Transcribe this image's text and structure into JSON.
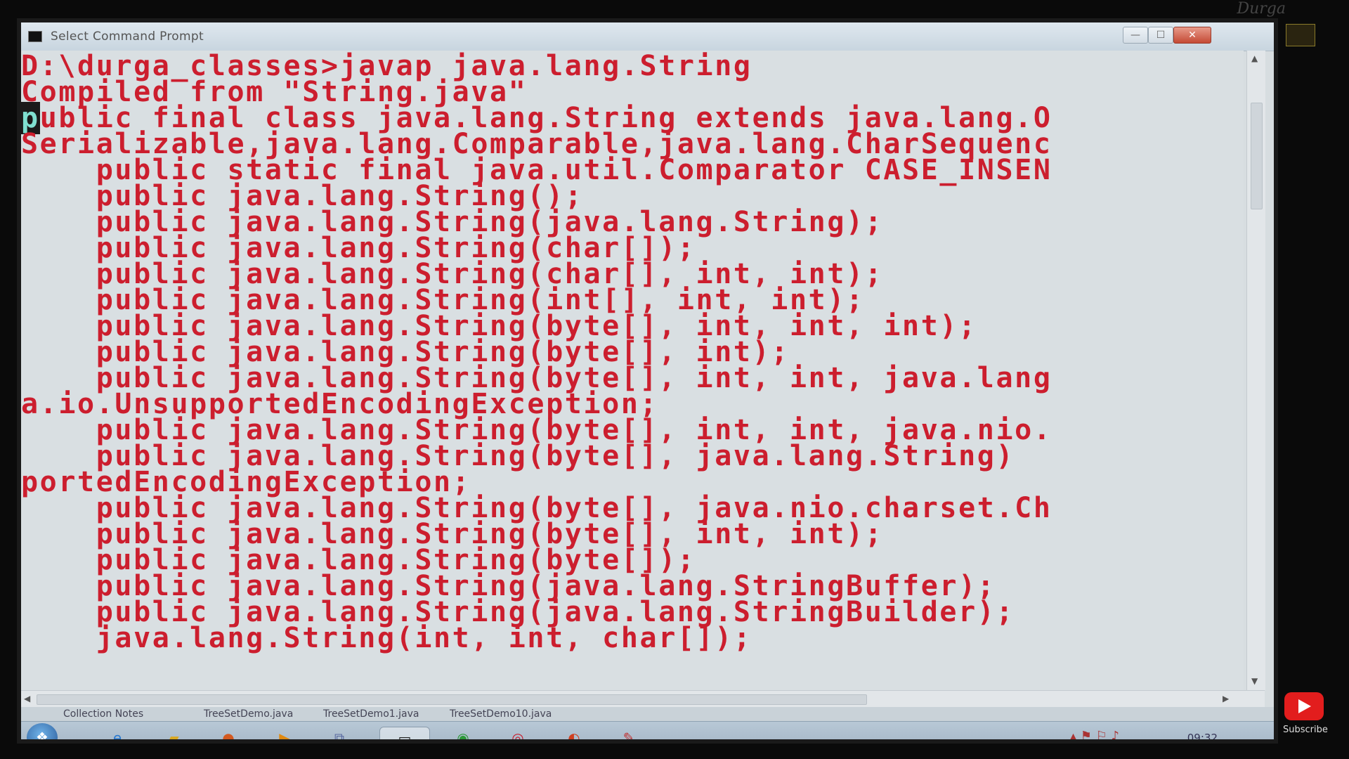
{
  "window": {
    "title": "Select Command Prompt",
    "min_label": "—",
    "max_label": "☐",
    "close_label": "✕"
  },
  "console": {
    "lines": [
      "D:\\durga_classes>javap java.lang.String",
      "Compiled from \"String.java\"",
      "public final class java.lang.String extends java.lang.O",
      "Serializable,java.lang.Comparable,java.lang.CharSequenc",
      "    public static final java.util.Comparator CASE_INSEN",
      "    public java.lang.String();",
      "    public java.lang.String(java.lang.String);",
      "    public java.lang.String(char[]);",
      "    public java.lang.String(char[], int, int);",
      "    public java.lang.String(int[], int, int);",
      "    public java.lang.String(byte[], int, int, int);",
      "    public java.lang.String(byte[], int);",
      "    public java.lang.String(byte[], int, int, java.lang",
      "a.io.UnsupportedEncodingException;",
      "    public java.lang.String(byte[], int, int, java.nio.",
      "    public java.lang.String(byte[], java.lang.String)",
      "portedEncodingException;",
      "    public java.lang.String(byte[], java.nio.charset.Ch",
      "    public java.lang.String(byte[], int, int);",
      "    public java.lang.String(byte[]);",
      "    public java.lang.String(java.lang.StringBuffer);",
      "    public java.lang.String(java.lang.StringBuilder);",
      "    java.lang.String(int, int, char[]);"
    ]
  },
  "tabs": [
    "Collection Notes",
    "TreeSetDemo.java",
    "TreeSetDemo1.java",
    "TreeSetDemo10.java"
  ],
  "taskbar": {
    "start_glyph": "❖",
    "clock": "09:32",
    "icons": [
      "ie-icon",
      "folder-icon",
      "firefox-icon",
      "media-player-icon",
      "network-icon",
      "cmd-icon",
      "chrome-icon",
      "opera-icon",
      "app-icon",
      "paint-icon"
    ]
  },
  "overlay": {
    "watermark": "Durga",
    "subscribe_label": "Subscribe"
  },
  "colors": {
    "console_text": "#cc1e2e",
    "console_bg": "#d9dfe2",
    "cursor_bg": "#1a1a1a"
  }
}
